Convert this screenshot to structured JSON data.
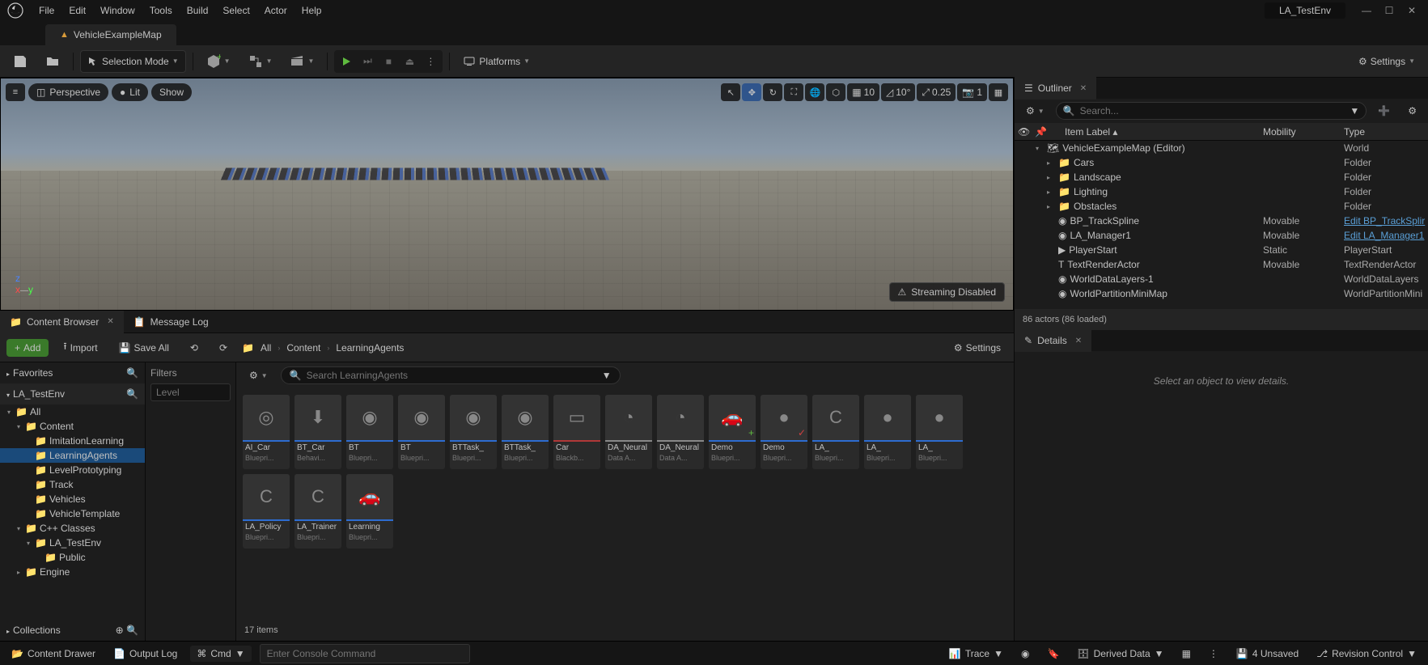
{
  "app": {
    "project": "LA_TestEnv"
  },
  "menu": [
    "File",
    "Edit",
    "Window",
    "Tools",
    "Build",
    "Select",
    "Actor",
    "Help"
  ],
  "tab": {
    "label": "VehicleExampleMap"
  },
  "toolbar": {
    "mode": "Selection Mode",
    "platforms": "Platforms",
    "settings": "Settings"
  },
  "viewport": {
    "hamburger": "≡",
    "perspective": "Perspective",
    "lit": "Lit",
    "show": "Show",
    "snap_grid": "10",
    "snap_angle": "10°",
    "snap_scale": "0.25",
    "camera_speed": "1",
    "streaming": "Streaming Disabled"
  },
  "panels": {
    "content_browser": "Content Browser",
    "message_log": "Message Log",
    "outliner": "Outliner",
    "details": "Details"
  },
  "cb": {
    "add": "Add",
    "import": "Import",
    "save_all": "Save All",
    "crumb_all": "All",
    "crumb_content": "Content",
    "crumb_la": "LearningAgents",
    "settings": "Settings",
    "favorites": "Favorites",
    "project": "LA_TestEnv",
    "collections": "Collections",
    "filters_hdr": "Filters",
    "filters_ph": "Level",
    "search_ph": "Search LearningAgents",
    "items_count": "17 items",
    "tree": [
      {
        "d": 0,
        "exp": "▾",
        "icon": "📁",
        "label": "All"
      },
      {
        "d": 1,
        "exp": "▾",
        "icon": "📁",
        "label": "Content"
      },
      {
        "d": 2,
        "exp": "",
        "icon": "📁",
        "label": "ImitationLearning"
      },
      {
        "d": 2,
        "exp": "",
        "icon": "📁",
        "label": "LearningAgents",
        "sel": true
      },
      {
        "d": 2,
        "exp": "",
        "icon": "📁",
        "label": "LevelPrototyping"
      },
      {
        "d": 2,
        "exp": "",
        "icon": "📁",
        "label": "Track"
      },
      {
        "d": 2,
        "exp": "",
        "icon": "📁",
        "label": "Vehicles"
      },
      {
        "d": 2,
        "exp": "",
        "icon": "📁",
        "label": "VehicleTemplate"
      },
      {
        "d": 1,
        "exp": "▾",
        "icon": "📁",
        "label": "C++ Classes"
      },
      {
        "d": 2,
        "exp": "▾",
        "icon": "📁",
        "label": "LA_TestEnv"
      },
      {
        "d": 3,
        "exp": "",
        "icon": "📁",
        "label": "Public"
      },
      {
        "d": 1,
        "exp": "▸",
        "icon": "📁",
        "label": "Engine"
      }
    ],
    "assets": [
      {
        "name": "AI_Car",
        "type": "Bluepri...",
        "stripe": "#2d6cd0",
        "glyph": "◎"
      },
      {
        "name": "BT_Car",
        "type": "Behavi...",
        "stripe": "#2d6cd0",
        "glyph": "⬇"
      },
      {
        "name": "BT",
        "type": "Bluepri...",
        "stripe": "#2d6cd0",
        "glyph": "◉"
      },
      {
        "name": "BT",
        "type": "Bluepri...",
        "stripe": "#2d6cd0",
        "glyph": "◉"
      },
      {
        "name": "BTTask_",
        "type": "Bluepri...",
        "stripe": "#2d6cd0",
        "glyph": "◉"
      },
      {
        "name": "BTTask_",
        "type": "Bluepri...",
        "stripe": "#2d6cd0",
        "glyph": "◉"
      },
      {
        "name": "Car",
        "type": "Blackb...",
        "stripe": "#b03838",
        "glyph": "▭"
      },
      {
        "name": "DA_Neural",
        "type": "Data A...",
        "stripe": "#888",
        "glyph": "◔"
      },
      {
        "name": "DA_Neural",
        "type": "Data A...",
        "stripe": "#888",
        "glyph": "◔"
      },
      {
        "name": "Demo",
        "type": "Bluepri...",
        "stripe": "#2d6cd0",
        "glyph": "🚗",
        "badge": "+"
      },
      {
        "name": "Demo",
        "type": "Bluepri...",
        "stripe": "#2d6cd0",
        "glyph": "●",
        "badge": "✓"
      },
      {
        "name": "LA_",
        "type": "Bluepri...",
        "stripe": "#2d6cd0",
        "glyph": "C"
      },
      {
        "name": "LA_",
        "type": "Bluepri...",
        "stripe": "#2d6cd0",
        "glyph": "●"
      },
      {
        "name": "LA_",
        "type": "Bluepri...",
        "stripe": "#2d6cd0",
        "glyph": "●"
      },
      {
        "name": "LA_Policy",
        "type": "Bluepri...",
        "stripe": "#2d6cd0",
        "glyph": "C"
      },
      {
        "name": "LA_Trainer",
        "type": "Bluepri...",
        "stripe": "#2d6cd0",
        "glyph": "C"
      },
      {
        "name": "Learning",
        "type": "Bluepri...",
        "stripe": "#2d6cd0",
        "glyph": "🚗"
      }
    ]
  },
  "outliner": {
    "search_ph": "Search...",
    "col1": "Item Label ▴",
    "col2": "Mobility",
    "col3": "Type",
    "rows": [
      {
        "d": 0,
        "exp": "▾",
        "icon": "🗺",
        "label": "VehicleExampleMap (Editor)",
        "mob": "",
        "type": "World"
      },
      {
        "d": 1,
        "exp": "▸",
        "icon": "📁",
        "label": "Cars",
        "mob": "",
        "type": "Folder",
        "fold": true
      },
      {
        "d": 1,
        "exp": "▸",
        "icon": "📁",
        "label": "Landscape",
        "mob": "",
        "type": "Folder",
        "fold": true
      },
      {
        "d": 1,
        "exp": "▸",
        "icon": "📁",
        "label": "Lighting",
        "mob": "",
        "type": "Folder",
        "fold": true
      },
      {
        "d": 1,
        "exp": "▸",
        "icon": "📁",
        "label": "Obstacles",
        "mob": "",
        "type": "Folder",
        "fold": true
      },
      {
        "d": 1,
        "exp": "",
        "icon": "◉",
        "label": "BP_TrackSpline",
        "mob": "Movable",
        "type": "Edit BP_TrackSplir",
        "link": true
      },
      {
        "d": 1,
        "exp": "",
        "icon": "◉",
        "label": "LA_Manager1",
        "mob": "Movable",
        "type": "Edit LA_Manager1",
        "link": true
      },
      {
        "d": 1,
        "exp": "",
        "icon": "▶",
        "label": "PlayerStart",
        "mob": "Static",
        "type": "PlayerStart"
      },
      {
        "d": 1,
        "exp": "",
        "icon": "T",
        "label": "TextRenderActor",
        "mob": "Movable",
        "type": "TextRenderActor"
      },
      {
        "d": 1,
        "exp": "",
        "icon": "◉",
        "label": "WorldDataLayers-1",
        "mob": "",
        "type": "WorldDataLayers"
      },
      {
        "d": 1,
        "exp": "",
        "icon": "◉",
        "label": "WorldPartitionMiniMap",
        "mob": "",
        "type": "WorldPartitionMini"
      }
    ],
    "footer": "86 actors (86 loaded)"
  },
  "details": {
    "empty": "Select an object to view details."
  },
  "status": {
    "content_drawer": "Content Drawer",
    "output_log": "Output Log",
    "cmd": "Cmd",
    "console_ph": "Enter Console Command",
    "trace": "Trace",
    "derived": "Derived Data",
    "unsaved": "4 Unsaved",
    "revision": "Revision Control"
  }
}
